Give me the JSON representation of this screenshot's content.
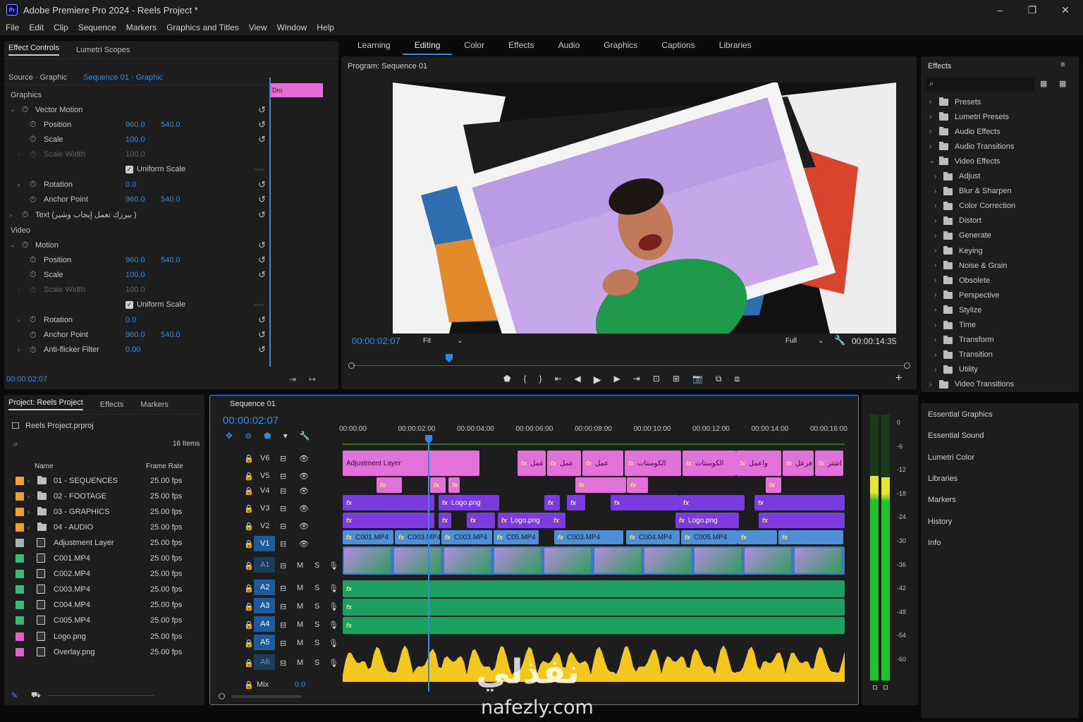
{
  "app": {
    "title": "Adobe Premiere Pro 2024 - Reels Project *",
    "icon_label": "Pr"
  },
  "window": {
    "minimize": "–",
    "restore": "❐",
    "close": "✕"
  },
  "menu": [
    "File",
    "Edit",
    "Clip",
    "Sequence",
    "Markers",
    "Graphics and Titles",
    "View",
    "Window",
    "Help"
  ],
  "workspaces": {
    "items": [
      "Learning",
      "Editing",
      "Color",
      "Effects",
      "Audio",
      "Graphics",
      "Captions",
      "Libraries"
    ],
    "active": "Editing"
  },
  "effect_controls": {
    "tabs": [
      "Effect Controls",
      "Lumetri Scopes"
    ],
    "source": "Source · Graphic",
    "sequence": "Sequence 01 · Graphic",
    "section_graphics": "Graphics",
    "vector_motion": "Vector Motion",
    "text_layer": "Text (بيرزك تعمل إيجاب وشير )",
    "section_video": "Video",
    "motion": "Motion",
    "vector_props": [
      {
        "name": "Position",
        "v1": "960.0",
        "v2": "540.0",
        "dim": false
      },
      {
        "name": "Scale",
        "v1": "100.0",
        "v2": "",
        "dim": false
      },
      {
        "name": "Scale Width",
        "v1": "100.0",
        "v2": "",
        "dim": true
      },
      {
        "name": "Uniform Scale",
        "v1": "",
        "v2": "",
        "dim": false,
        "checkbox": true
      },
      {
        "name": "Rotation",
        "v1": "0.0",
        "v2": "",
        "dim": false
      },
      {
        "name": "Anchor Point",
        "v1": "960.0",
        "v2": "540.0",
        "dim": false
      }
    ],
    "motion_props": [
      {
        "name": "Position",
        "v1": "960.0",
        "v2": "540.0",
        "dim": false
      },
      {
        "name": "Scale",
        "v1": "100.0",
        "v2": "",
        "dim": false
      },
      {
        "name": "Scale Width",
        "v1": "100.0",
        "v2": "",
        "dim": true
      },
      {
        "name": "Uniform Scale",
        "v1": "",
        "v2": "",
        "dim": false,
        "checkbox": true
      },
      {
        "name": "Rotation",
        "v1": "0.0",
        "v2": "",
        "dim": false
      },
      {
        "name": "Anchor Point",
        "v1": "960.0",
        "v2": "540.0",
        "dim": false
      },
      {
        "name": "Anti-flicker Filter",
        "v1": "0.00",
        "v2": "",
        "dim": false
      }
    ],
    "mini_clip": "Dro",
    "timecode": "00:00:02:07"
  },
  "program": {
    "title": "Program: Sequence 01",
    "timecode": "00:00:02:07",
    "fit": "Fit",
    "quality": "Full",
    "duration": "00:00:14:35"
  },
  "effects_panel": {
    "title": "Effects",
    "folders": [
      "Presets",
      "Lumetri Presets",
      "Audio Effects",
      "Audio Transitions",
      "Video Effects"
    ],
    "subfolders": [
      "Adjust",
      "Blur & Sharpen",
      "Color Correction",
      "Distort",
      "Generate",
      "Keying",
      "Noise & Grain",
      "Obsolete",
      "Perspective",
      "Stylize",
      "Time",
      "Transform",
      "Transition",
      "Utility"
    ],
    "last": "Video Transitions"
  },
  "side_panels": [
    "Essential Graphics",
    "Essential Sound",
    "Lumetri Color",
    "Libraries",
    "Markers",
    "History",
    "Info"
  ],
  "project": {
    "tabs": [
      "Project: Reels Project",
      "Effects",
      "Markers"
    ],
    "file": "Reels Project.prproj",
    "count": "16 Items",
    "col_name": "Name",
    "col_rate": "Frame Rate",
    "items": [
      {
        "name": "01 - SEQUENCES",
        "rate": "25.00 fps",
        "color": "#f0a030",
        "type": "bin"
      },
      {
        "name": "02 - FOOTAGE",
        "rate": "25.00 fps",
        "color": "#f0a030",
        "type": "bin"
      },
      {
        "name": "03 - GRAPHICS",
        "rate": "25.00 fps",
        "color": "#f0a030",
        "type": "bin"
      },
      {
        "name": "04 - AUDIO",
        "rate": "25.00 fps",
        "color": "#f0a030",
        "type": "bin"
      },
      {
        "name": "Adjustment Layer",
        "rate": "25.00 fps",
        "color": "#a0b8b0",
        "type": "item"
      },
      {
        "name": "C001.MP4",
        "rate": "25.00 fps",
        "color": "#3cb878",
        "type": "item"
      },
      {
        "name": "C002.MP4",
        "rate": "25.00 fps",
        "color": "#3cb878",
        "type": "item"
      },
      {
        "name": "C003.MP4",
        "rate": "25.00 fps",
        "color": "#3cb878",
        "type": "item"
      },
      {
        "name": "C004.MP4",
        "rate": "25.00 fps",
        "color": "#3cb878",
        "type": "item"
      },
      {
        "name": "C005.MP4",
        "rate": "25.00 fps",
        "color": "#3cb878",
        "type": "item"
      },
      {
        "name": "Logo.png",
        "rate": "25.00 fps",
        "color": "#e060d0",
        "type": "item"
      },
      {
        "name": "Overlay.png",
        "rate": "25.00 fps",
        "color": "#e060d0",
        "type": "item"
      }
    ]
  },
  "timeline": {
    "title": "Sequence 01",
    "timecode": "00:00:02:07",
    "ruler": [
      "00:00:00",
      "00:00:02:00",
      "00:00:04:00",
      "00:00:06:00",
      "00:00:08:00",
      "00:00:10:00",
      "00:00:12:00",
      "00:00:14:00",
      "00:00:16:00"
    ],
    "video_tracks": [
      "V6",
      "V5",
      "V4",
      "V3",
      "V2",
      "V1"
    ],
    "audio_tracks": [
      "A1",
      "A2",
      "A3",
      "A4",
      "A5",
      "A6"
    ],
    "mix_label": "Mix",
    "mix_value": "0.0",
    "track_buttons": {
      "mute": "M",
      "solo": "S"
    },
    "adjustment_clip": "Adjustment Layer",
    "v6_texts": [
      "عمل",
      "عمل",
      "عمل",
      "الكومنتات",
      "الكومنتات",
      "واعمل",
      "فرعل",
      "اشتر"
    ],
    "logo_clip": "Logo.png",
    "v1_clips": [
      "C001.MP4",
      "C003.MP4",
      "C003.MP4",
      "C05.MP4",
      "C003.MP4",
      "C004.MP4",
      "C005.MP4"
    ]
  },
  "meter": {
    "scale": [
      "0",
      "-6",
      "-12",
      "-18",
      "-24",
      "-30",
      "-36",
      "-42",
      "-48",
      "-54",
      "-60"
    ],
    "extra": "-24"
  },
  "watermark": {
    "arabic": "نفذلي",
    "latin": "nafezly.com"
  }
}
